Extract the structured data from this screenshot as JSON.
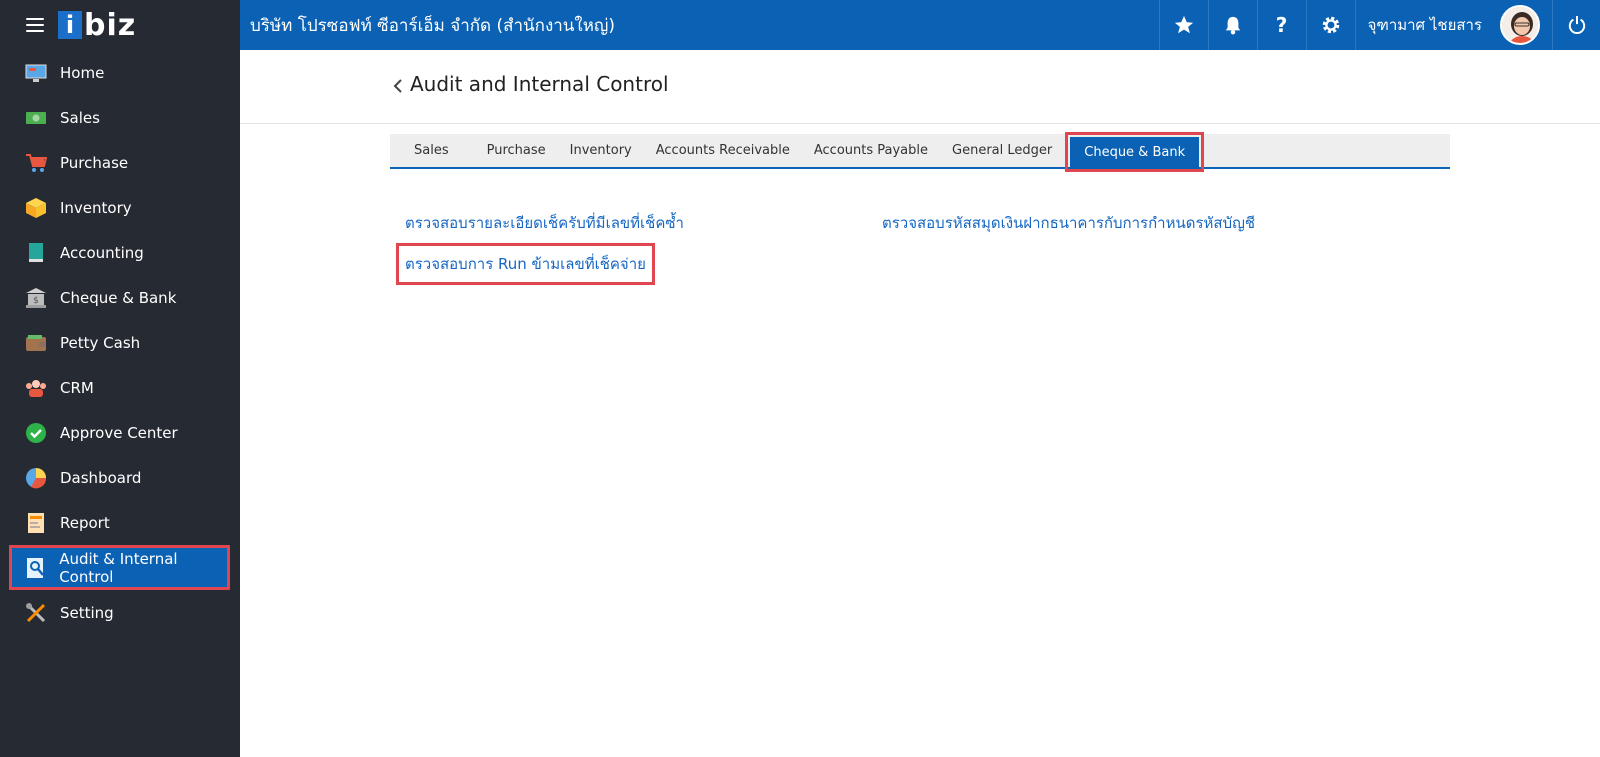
{
  "brand": {
    "logo_letter": "i",
    "logo_text": "biz"
  },
  "sidebar": {
    "items": [
      {
        "label": "Home",
        "icon": "monitor-icon"
      },
      {
        "label": "Sales",
        "icon": "cash-icon"
      },
      {
        "label": "Purchase",
        "icon": "cart-icon"
      },
      {
        "label": "Inventory",
        "icon": "box-icon"
      },
      {
        "label": "Accounting",
        "icon": "book-icon"
      },
      {
        "label": "Cheque & Bank",
        "icon": "bank-icon"
      },
      {
        "label": "Petty Cash",
        "icon": "wallet-icon"
      },
      {
        "label": "CRM",
        "icon": "people-icon"
      },
      {
        "label": "Approve Center",
        "icon": "check-circle-icon"
      },
      {
        "label": "Dashboard",
        "icon": "pie-chart-icon"
      },
      {
        "label": "Report",
        "icon": "report-icon"
      },
      {
        "label": "Audit & Internal Control",
        "icon": "audit-icon"
      },
      {
        "label": "Setting",
        "icon": "tools-icon"
      }
    ],
    "active_index": 11
  },
  "header": {
    "company": "บริษัท โปรซอฟท์ ซีอาร์เอ็ม จำกัด (สำนักงานใหญ่)",
    "user_name": "จุฑามาศ ไชยสาร",
    "help_label": "?"
  },
  "page": {
    "title": "Audit and Internal Control"
  },
  "tabs": [
    "Sales",
    "Purchase",
    "Inventory",
    "Accounts Receivable",
    "Accounts Payable",
    "General Ledger",
    "Cheque & Bank"
  ],
  "active_tab": 6,
  "links": {
    "left_1": "ตรวจสอบรายละเอียดเช็ครับที่มีเลขที่เช็คซ้ำ",
    "left_2": "ตรวจสอบการ Run ข้ามเลขที่เช็คจ่าย",
    "right_1": "ตรวจสอบรหัสสมุดเงินฝากธนาคารกับการกำหนดรหัสบัญชี"
  },
  "colors": {
    "primary": "#0b62b4",
    "sidebar": "#262a33",
    "highlight": "#e0464f",
    "link": "#1667c4"
  }
}
